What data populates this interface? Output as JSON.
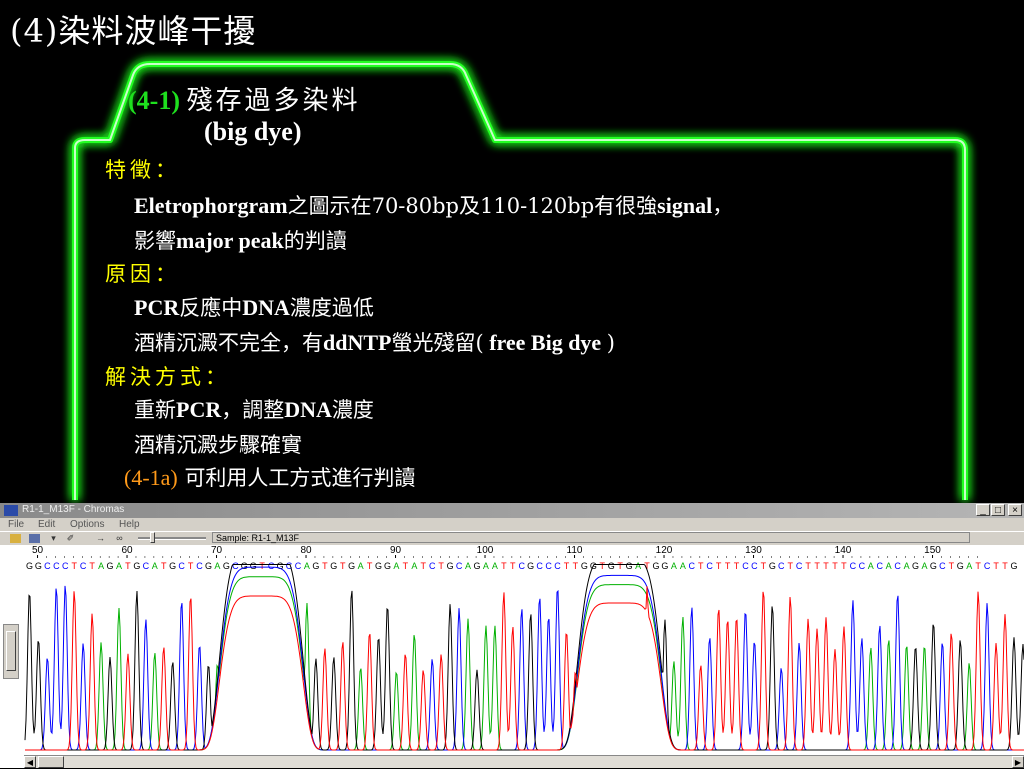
{
  "slide": {
    "title": "(4)染料波峰干擾",
    "subtitle_num": "(4-1)",
    "subtitle_cn": "殘存過多染料",
    "subtitle_en": "(big dye)",
    "features_heading": "特徵：",
    "features": [
      [
        "Eletrophorgram",
        "之圖示在70-80bp及110-120bp有很強",
        "signal",
        "，"
      ],
      [
        "影響",
        "major peak",
        "的判讀"
      ]
    ],
    "cause_heading": "原因：",
    "causes": [
      [
        "PCR",
        "反應中",
        "DNA",
        "濃度過低"
      ],
      [
        "酒精沉澱不完全，有",
        "ddNTP",
        "螢光殘留(",
        " free Big dye ",
        ")"
      ]
    ],
    "solution_heading": "解決方式：",
    "solutions": [
      [
        "重新",
        "PCR",
        "，調整",
        "DNA",
        "濃度"
      ],
      [
        "酒精沉澱步驟確實"
      ]
    ],
    "note_num": "(4-1a)",
    "note_text": "可利用人工方式進行判讀"
  },
  "colors": {
    "frame_glow": "#22ff22",
    "subtitle_num": "#1ee01e",
    "heading": "#ffff00",
    "note_num": "#ff9a1a",
    "trace_A": "#00b000",
    "trace_C": "#0000ff",
    "trace_G": "#000000",
    "trace_T": "#ff0000"
  },
  "window": {
    "title": "R1-1_M13F - Chromas",
    "menu": [
      "File",
      "Edit",
      "Options",
      "Help"
    ],
    "sample_label": "Sample: R1-1_M13F",
    "controls": [
      "_",
      "□",
      "×"
    ]
  },
  "chart_data": {
    "type": "line",
    "title": "",
    "xlabel": "",
    "ylabel": "",
    "tick_labels": [
      "50",
      "60",
      "70",
      "80",
      "90",
      "100",
      "110",
      "120",
      "130",
      "140",
      "150"
    ],
    "sequence": "GGCCCTCTAGATGCATGCTCGAGCGGTCGCCAGTGTGATGGATATCTGCAGAATTCGCCCTTGGTGTGATGGAACTCTTTCCTGCTCTTTTTCCACACAGAGCTGATCTTGG",
    "series": [
      {
        "name": "A"
      },
      {
        "name": "C"
      },
      {
        "name": "G"
      },
      {
        "name": "T"
      }
    ],
    "dye_blob_regions_bp": [
      [
        70,
        80
      ],
      [
        110,
        120
      ]
    ]
  }
}
